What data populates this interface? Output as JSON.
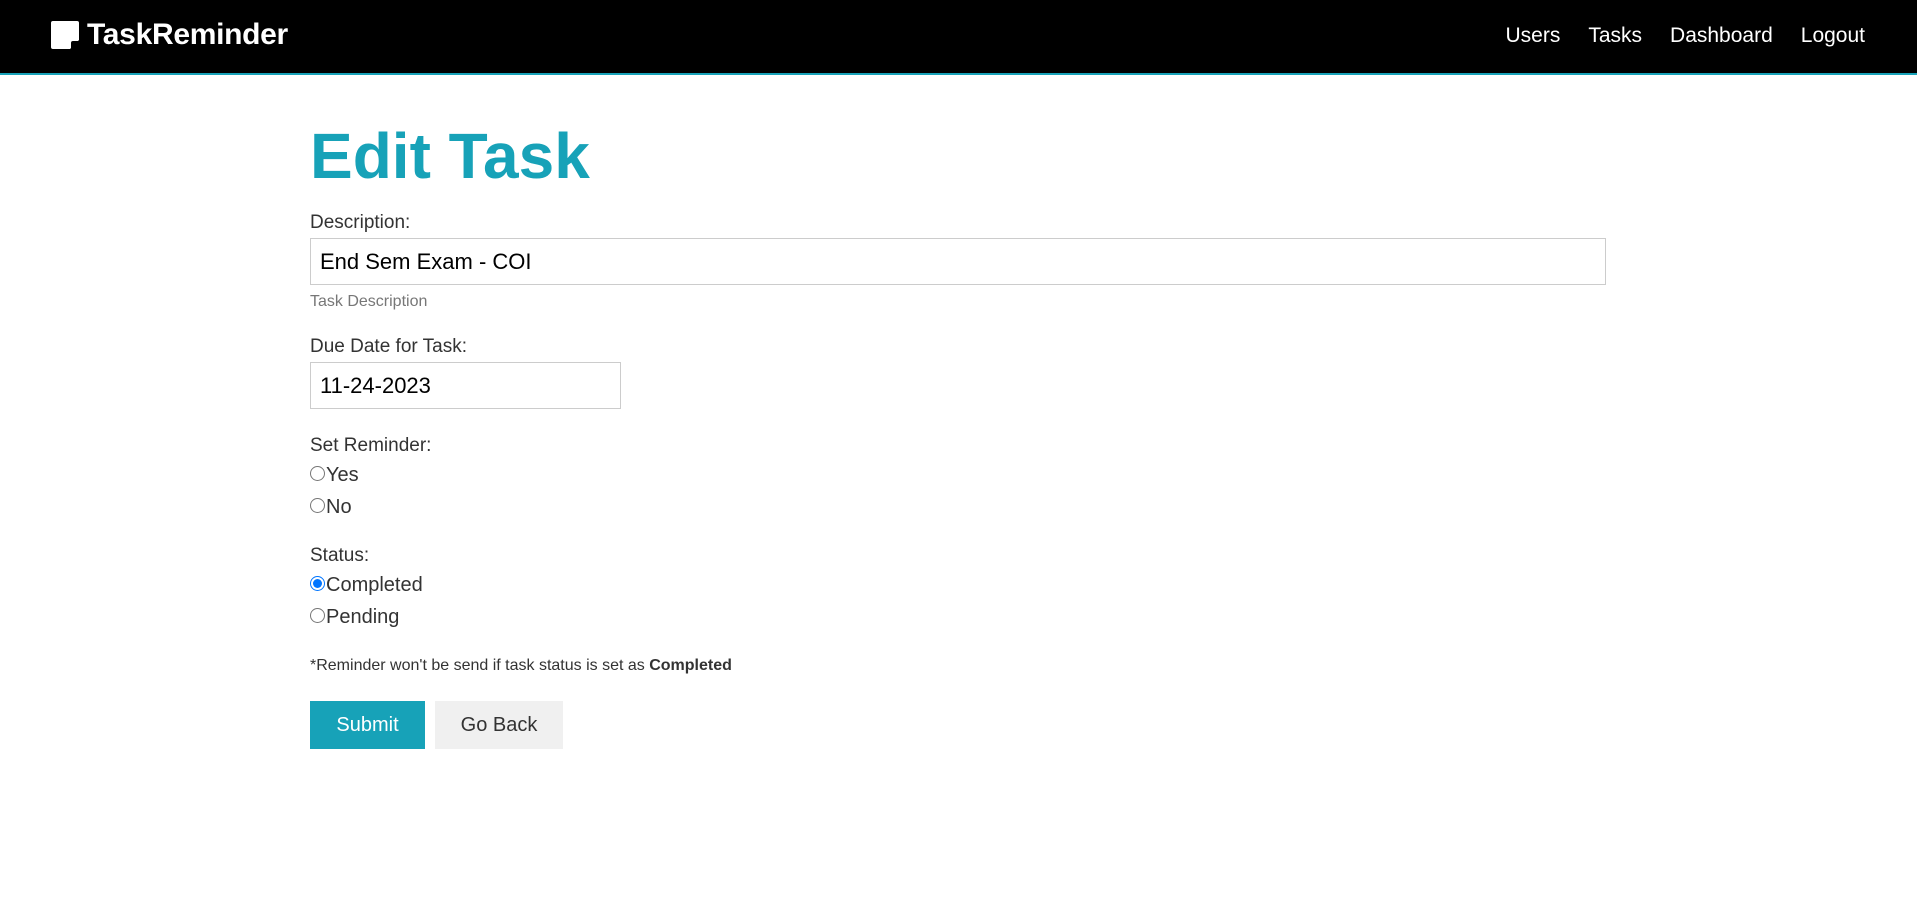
{
  "navbar": {
    "brand": "TaskReminder",
    "brand_icon": "sticky-note-icon",
    "links": [
      "Users",
      "Tasks",
      "Dashboard",
      "Logout"
    ]
  },
  "page": {
    "title": "Edit Task"
  },
  "form": {
    "description": {
      "label": "Description:",
      "value": "End Sem Exam - COI",
      "help": "Task Description"
    },
    "due_date": {
      "label": "Due Date for Task:",
      "value": "11-24-2023"
    },
    "reminder": {
      "label": "Set Reminder:",
      "options": [
        "Yes",
        "No"
      ],
      "selected": null
    },
    "status": {
      "label": "Status:",
      "options": [
        "Completed",
        "Pending"
      ],
      "selected": "Completed"
    },
    "note_prefix": "*Reminder won't be send if task status is set as ",
    "note_bold": "Completed",
    "submit_label": "Submit",
    "back_label": "Go Back"
  },
  "colors": {
    "accent": "#17a2b8",
    "navbar_bg": "#000000",
    "radio_checked": "#0075ff"
  }
}
